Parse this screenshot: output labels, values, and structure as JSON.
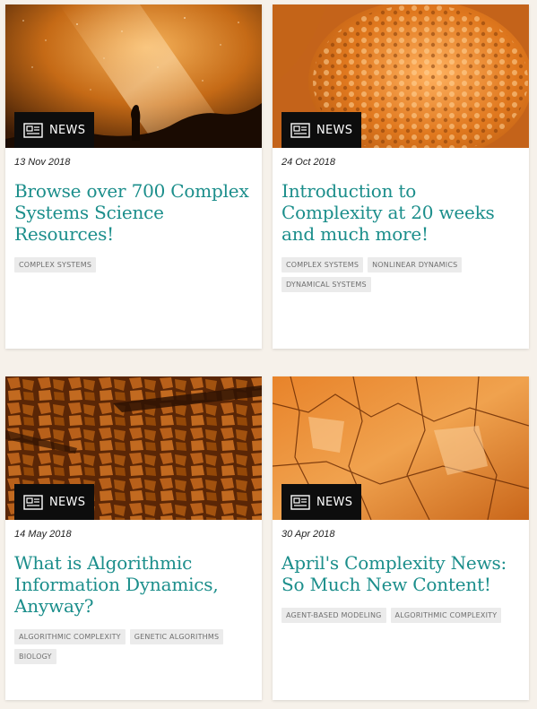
{
  "theme": {
    "title_color": "#1b8e8b",
    "badge_color": "#0d0d0d",
    "tag_bg": "#ebebeb",
    "page_bg": "#f6f1ea",
    "image_tint": "#e37b1d"
  },
  "cards": [
    {
      "badge": "NEWS",
      "badge_icon": "newspaper-icon",
      "image": "starry-sky-silhouette",
      "date": "13 Nov 2018",
      "title": "Browse over 700 Complex Systems Science Resources!",
      "tags": [
        "COMPLEX SYSTEMS"
      ]
    },
    {
      "badge": "NEWS",
      "badge_icon": "newspaper-icon",
      "image": "glowing-cell-cluster",
      "date": "24 Oct 2018",
      "title": "Introduction to Complexity at 20 weeks and much more!",
      "tags": [
        "COMPLEX SYSTEMS",
        "NONLINEAR DYNAMICS",
        "DYNAMICAL SYSTEMS"
      ]
    },
    {
      "badge": "NEWS",
      "badge_icon": "newspaper-icon",
      "image": "tree-canopy-crown-shyness",
      "date": "14 May 2018",
      "title": "What is Algorithmic Information Dynamics, Anyway?",
      "tags": [
        "ALGORITHMIC COMPLEXITY",
        "GENETIC ALGORITHMS",
        "BIOLOGY"
      ]
    },
    {
      "badge": "NEWS",
      "badge_icon": "newspaper-icon",
      "image": "cracked-rock-texture",
      "date": "30 Apr 2018",
      "title": "April's Complexity News: So Much New Content!",
      "tags": [
        "AGENT-BASED MODELING",
        "ALGORITHMIC COMPLEXITY"
      ]
    }
  ]
}
